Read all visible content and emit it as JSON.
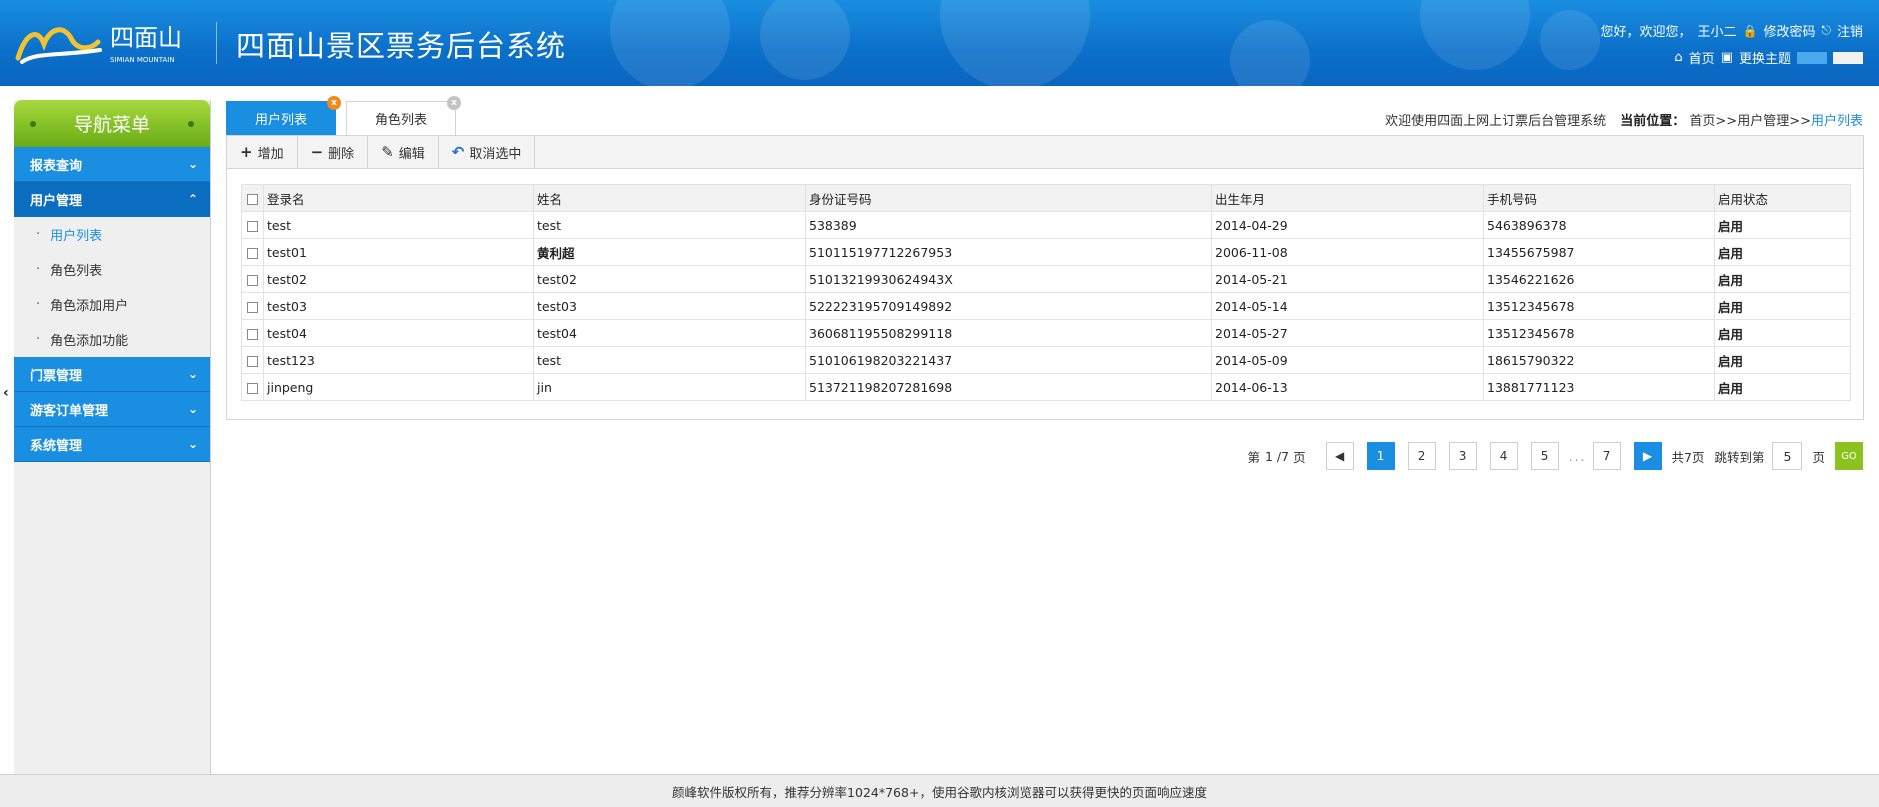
{
  "header": {
    "logo_text": "四面山",
    "logo_subtext": "SIMIAN MOUNTAIN",
    "title": "四面山景区票务后台系统",
    "greeting": "您好，欢迎您，",
    "username": "王小二",
    "change_password": "修改密码",
    "logout": "注销",
    "home": "首页",
    "change_theme": "更换主题",
    "theme_colors": [
      "#4aa8ec",
      "#f2f2f2"
    ]
  },
  "sidebar": {
    "title": "导航菜单",
    "groups": [
      {
        "label": "报表查询"
      },
      {
        "label": "用户管理",
        "items": [
          "用户列表",
          "角色列表",
          "角色添加用户",
          "角色添加功能"
        ]
      },
      {
        "label": "门票管理"
      },
      {
        "label": "游客订单管理"
      },
      {
        "label": "系统管理"
      }
    ]
  },
  "tabs": [
    {
      "label": "用户列表",
      "close": "x"
    },
    {
      "label": "角色列表",
      "close": "x"
    }
  ],
  "breadcrumb": {
    "welcome": "欢迎使用四面上网上订票后台管理系统",
    "label": "当前位置：",
    "path": "首页>>用户管理>>",
    "current": "用户列表"
  },
  "toolbar": {
    "add": "增加",
    "delete": "删除",
    "edit": "编辑",
    "cancel": "取消选中"
  },
  "table": {
    "columns": [
      "登录名",
      "姓名",
      "身份证号码",
      "出生年月",
      "手机号码",
      "启用状态"
    ],
    "rows": [
      [
        "test",
        "test",
        "538389",
        "2014-04-29",
        "5463896378",
        "启用"
      ],
      [
        "test01",
        "黄利超",
        "510115197712267953",
        "2006-11-08",
        "13455675987",
        "启用"
      ],
      [
        "test02",
        "test02",
        "51013219930624943X",
        "2014-05-21",
        "13546221626",
        "启用"
      ],
      [
        "test03",
        "test03",
        "522223195709149892",
        "2014-05-14",
        "13512345678",
        "启用"
      ],
      [
        "test04",
        "test04",
        "360681195508299118",
        "2014-05-27",
        "13512345678",
        "启用"
      ],
      [
        "test123",
        "test",
        "510106198203221437",
        "2014-05-09",
        "18615790322",
        "启用"
      ],
      [
        "jinpeng",
        "jin",
        "513721198207281698",
        "2014-06-13",
        "13881771123",
        "启用"
      ]
    ]
  },
  "pagination": {
    "page_prefix": "第",
    "current_page": "1",
    "page_total_text": "/7",
    "page_suffix": "页",
    "pages": [
      "1",
      "2",
      "3",
      "4",
      "5"
    ],
    "ellipsis": "...",
    "last_page": "7",
    "total_text": "共7页",
    "jump_label": "跳转到第",
    "jump_value": "5",
    "jump_suffix": "页",
    "go_label": "GO"
  },
  "footer": {
    "text": "颜峰软件版权所有，推荐分辨率1024*768+，使用谷歌内核浏览器可以获得更快的页面响应速度"
  },
  "colors": {
    "primary": "#1a8ee0",
    "nav_green": "#8cc21e",
    "tab_close_orange": "#f08a1c"
  }
}
